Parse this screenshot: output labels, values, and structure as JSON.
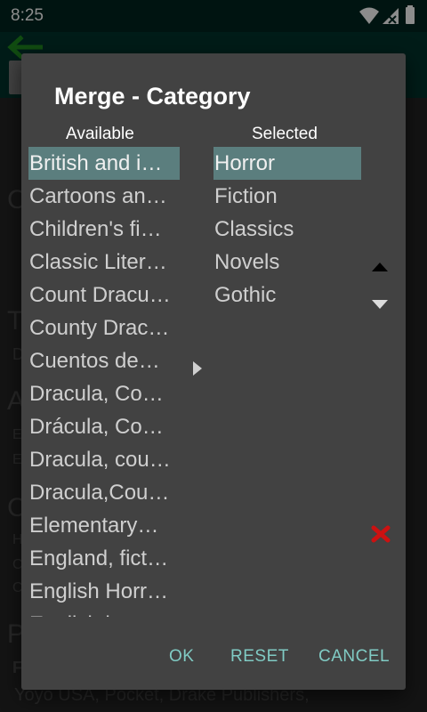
{
  "status": {
    "time": "8:25"
  },
  "background": {
    "lines": [
      "C",
      "T",
      "D",
      "A",
      "E",
      "E",
      "C",
      "H",
      "C",
      "C",
      "P",
      "F",
      "Yoyo USA, Pocket, Drake Publishers,"
    ]
  },
  "dialog": {
    "title": "Merge - Category",
    "available_header": "Available",
    "selected_header": "Selected",
    "available": [
      "British and i…",
      "Cartoons an…",
      "Children's fi…",
      "Classic Liter…",
      "Count Dracu…",
      "County Drac…",
      "Cuentos de…",
      "Dracula, Co…",
      "Drácula, Co…",
      "Dracula, cou…",
      "Dracula,Cou…",
      "Elementary…",
      "England, fict…",
      "English Horr…",
      "English h…"
    ],
    "selected": [
      "Horror",
      "Fiction",
      "Classics",
      "Novels",
      "Gothic"
    ],
    "buttons": {
      "ok": "OK",
      "reset": "RESET",
      "cancel": "CANCEL"
    },
    "colors": {
      "accent": "#80cbc4",
      "highlight": "#5b7e7e",
      "delete": "#cc1111"
    }
  }
}
